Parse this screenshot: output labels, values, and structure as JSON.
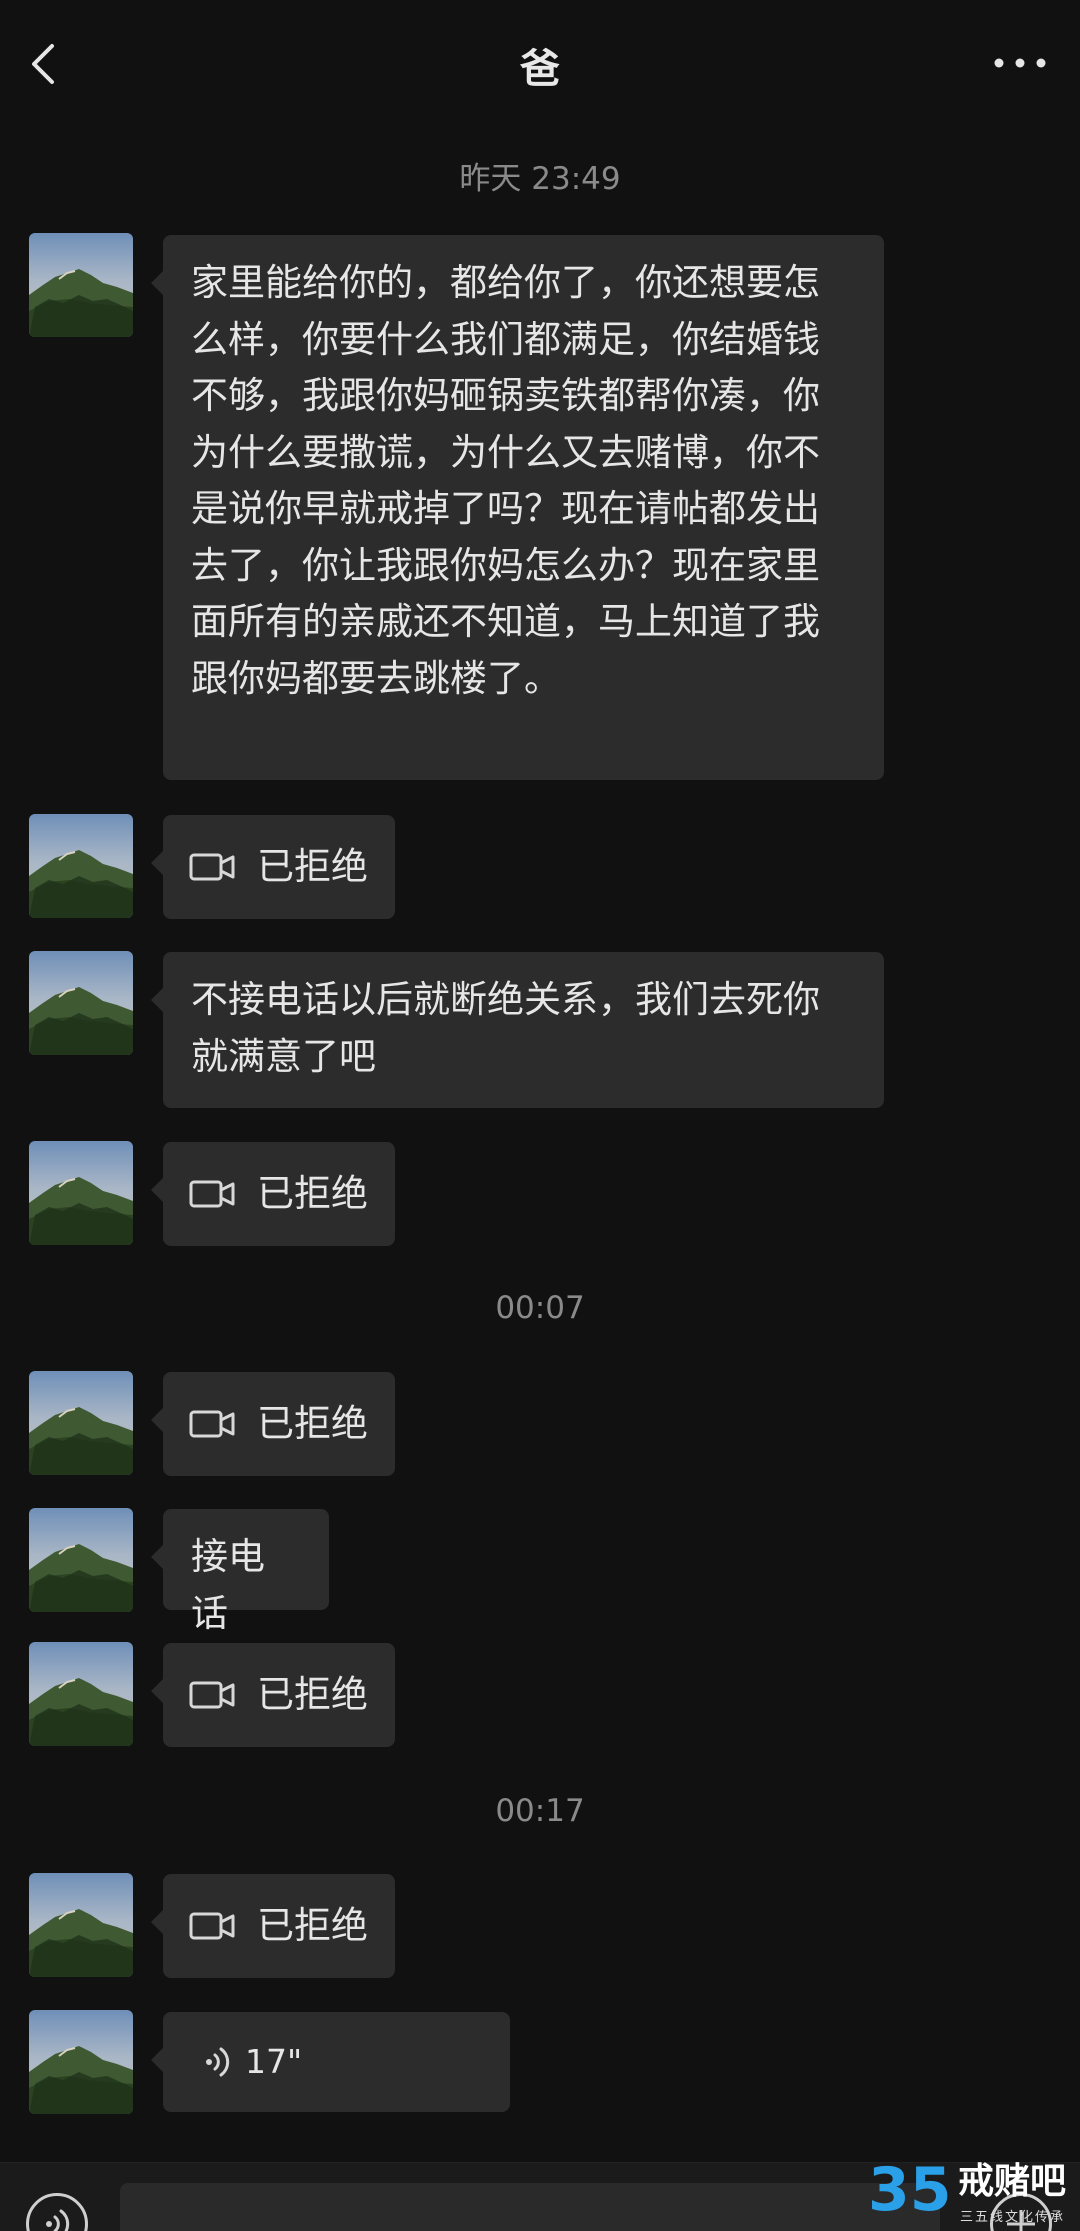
{
  "header": {
    "title": "爸",
    "back_icon": "chevron-left-icon",
    "more_icon": "more-dots-icon"
  },
  "timestamps": [
    "昨天 23:49",
    "00:07",
    "00:17"
  ],
  "messages": [
    {
      "type": "text",
      "text": "家里能给你的，都给你了，你还想要怎么样，你要什么我们都满足，你结婚钱不够，我跟你妈砸锅卖铁都帮你凑，你为什么要撒谎，为什么又去赌博，你不是说你早就戒掉了吗？现在请帖都发出去了，你让我跟你妈怎么办？现在家里面所有的亲戚还不知道，马上知道了我跟你妈都要去跳楼了。"
    },
    {
      "type": "video_call",
      "text": "已拒绝"
    },
    {
      "type": "text",
      "text": "不接电话以后就断绝关系，我们去死你就满意了吧"
    },
    {
      "type": "video_call",
      "text": "已拒绝"
    },
    {
      "type": "video_call",
      "text": "已拒绝"
    },
    {
      "type": "text",
      "text": "接电话"
    },
    {
      "type": "video_call",
      "text": "已拒绝"
    },
    {
      "type": "video_call",
      "text": "已拒绝"
    },
    {
      "type": "voice",
      "text": "17\""
    }
  ],
  "watermark": {
    "number": "35",
    "name": "戒赌吧",
    "subtitle": "三五线文化传承"
  },
  "colors": {
    "background": "#111111",
    "bubble": "#2c2c2c",
    "text": "#e6e6e6",
    "timestamp": "#8a8a8a",
    "watermark_blue": "#2aa0e8"
  }
}
